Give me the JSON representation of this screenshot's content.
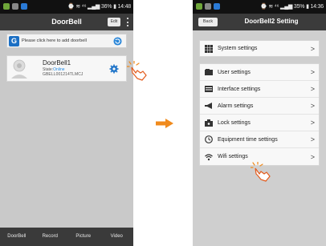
{
  "left": {
    "status": {
      "time": "14:48",
      "battery": "36%"
    },
    "title": "DoorBell",
    "edit_label": "Edit",
    "add_text": "Please click here to add doorbell",
    "device": {
      "name": "DoorBell1",
      "state_label": "State:",
      "state_value": "Online",
      "id": "GBELL001214TLMCJ"
    },
    "nav": [
      "DoorBell",
      "Record",
      "Picture",
      "Video"
    ]
  },
  "right": {
    "status": {
      "time": "14:36",
      "battery": "35%"
    },
    "back_label": "Back",
    "title": "DoorBell2  Setting",
    "system": "System settings",
    "items": [
      "User settings",
      "Interface settings",
      "Alarm settings",
      "Lock settings",
      "Equipment time settings",
      "Wifi settings"
    ],
    "chevron": ">"
  },
  "colors": {
    "accent": "#f08a1c",
    "link": "#1e88e5",
    "titlebar": "#3b3b3b"
  }
}
